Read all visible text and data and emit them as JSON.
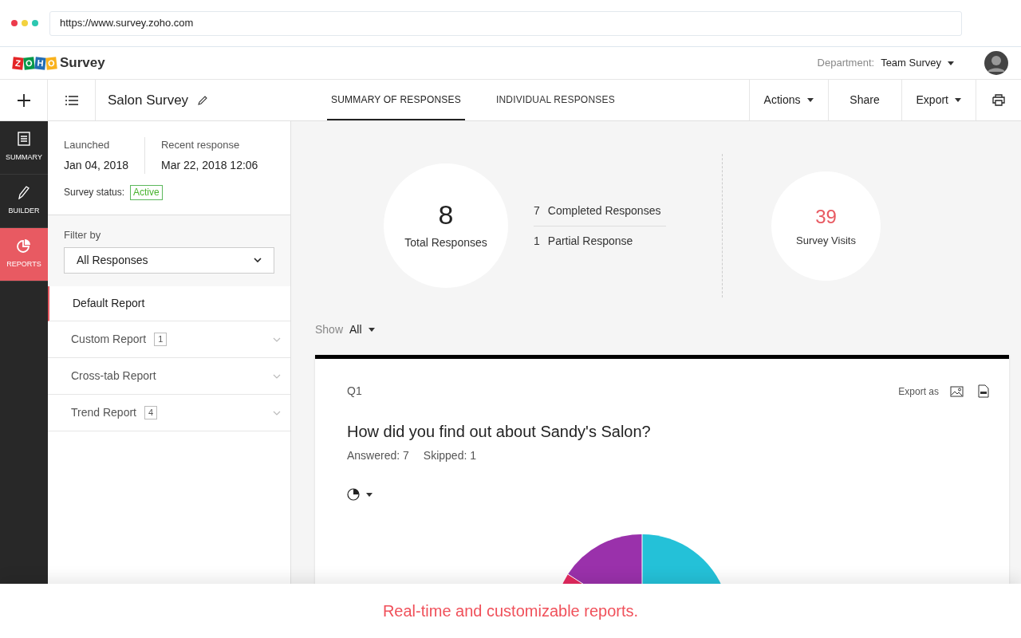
{
  "browser": {
    "url": "https://www.survey.zoho.com"
  },
  "header": {
    "logo_letters": [
      {
        "text": "Z",
        "color": "#e42527"
      },
      {
        "text": "O",
        "color": "#089949"
      },
      {
        "text": "H",
        "color": "#226db4"
      },
      {
        "text": "O",
        "color": "#f9b21d"
      }
    ],
    "product": "Survey",
    "department_label": "Department:",
    "department": "Team Survey"
  },
  "toolbar": {
    "survey_title": "Salon Survey",
    "tabs": [
      {
        "label": "SUMMARY OF RESPONSES",
        "selected": true
      },
      {
        "label": "INDIVIDUAL RESPONSES",
        "selected": false
      }
    ],
    "buttons": [
      {
        "label": "Actions",
        "kind": "dropdown"
      },
      {
        "label": "Share",
        "kind": "plain"
      },
      {
        "label": "Export",
        "kind": "dropdown"
      }
    ]
  },
  "rail": [
    {
      "label": "SUMMARY",
      "selected": false
    },
    {
      "label": "BUILDER",
      "selected": false
    },
    {
      "label": "REPORTS",
      "selected": true
    }
  ],
  "info": {
    "launched_label": "Launched",
    "launched": "Jan 04, 2018",
    "recent_label": "Recent response",
    "recent": "Mar 22, 2018 12:06",
    "status_label": "Survey status:",
    "status": "Active"
  },
  "filter": {
    "label": "Filter by",
    "value": "All Responses"
  },
  "reports": [
    {
      "label": "Default Report",
      "selected": true,
      "expandable": false
    },
    {
      "label": "Custom Report",
      "count": "1",
      "selected": false,
      "expandable": true
    },
    {
      "label": "Cross-tab Report",
      "selected": false,
      "expandable": true
    },
    {
      "label": "Trend Report",
      "count": "4",
      "selected": false,
      "expandable": true
    }
  ],
  "stats": {
    "total": "8",
    "total_label": "Total Responses",
    "breakdown": [
      {
        "count": "7",
        "label": "Completed Responses"
      },
      {
        "count": "1",
        "label": "Partial Response"
      }
    ],
    "visits": "39",
    "visits_label": "Survey Visits"
  },
  "show": {
    "label": "Show",
    "value": "All"
  },
  "question": {
    "number": "Q1",
    "export_label": "Export as",
    "text": "How did you find out about Sandy's Salon?",
    "answered": "Answered: 7",
    "skipped": "Skipped: 1"
  },
  "caption": "Real-time and customizable reports."
}
